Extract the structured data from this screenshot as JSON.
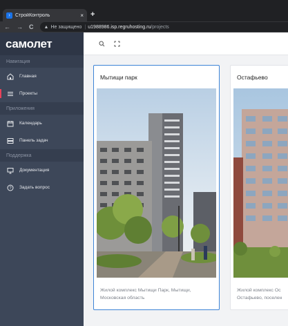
{
  "browser": {
    "tab_title": "СтройКонтроль",
    "tab_close": "×",
    "new_tab": "+",
    "nav": {
      "back": "←",
      "forward": "→",
      "reload": "C"
    },
    "insecure_label": "Не защищено",
    "url_host": "u1988986.isp.regruhosting.ru",
    "url_path": "/projects"
  },
  "sidebar": {
    "brand": "самолет",
    "sections": [
      {
        "header": "Навигация",
        "items": [
          {
            "label": "Главная",
            "icon": "home-icon"
          },
          {
            "label": "Проекты",
            "icon": "menu-icon",
            "active": true
          }
        ]
      },
      {
        "header": "Приложения",
        "items": [
          {
            "label": "Календарь",
            "icon": "calendar-icon"
          },
          {
            "label": "Панель задач",
            "icon": "task-board-icon"
          }
        ]
      },
      {
        "header": "Поддержка",
        "items": [
          {
            "label": "Документация",
            "icon": "monitor-icon"
          },
          {
            "label": "Задать вопрос",
            "icon": "help-icon"
          }
        ]
      }
    ]
  },
  "topbar": {
    "icons": [
      "search-icon",
      "fullscreen-icon"
    ]
  },
  "projects": [
    {
      "title": "Мытищи парк",
      "desc_line1": "Жилой комплекс Мытищи Парк, Мытищи,",
      "desc_line2": "Московская область"
    },
    {
      "title": "Остафьево",
      "desc_line1": "Жилой комплекс Ос",
      "desc_line2": "Остафьево, поселен"
    }
  ]
}
